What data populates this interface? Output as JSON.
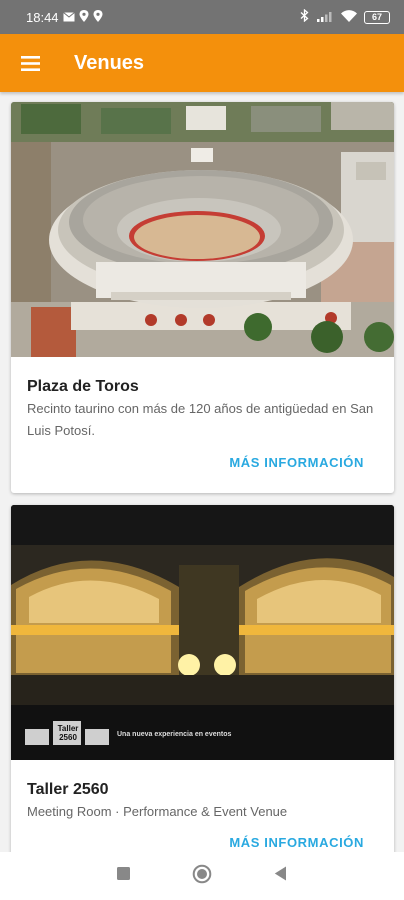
{
  "status_bar": {
    "time": "18:44",
    "battery_level": "67"
  },
  "app_bar": {
    "title": "Venues",
    "color": "#f4900c"
  },
  "venues": [
    {
      "name": "Plaza de Toros",
      "description": "Recinto taurino con más de 120 años de antigüedad en San Luis Potosí.",
      "action_label": "MÁS INFORMACIÓN"
    },
    {
      "name": "Taller 2560",
      "description": "Meeting Room · Performance & Event Venue",
      "action_label": "MÁS INFORMACIÓN",
      "image_caption": "Una nueva experiencia en eventos",
      "image_logo": "Taller 2560"
    }
  ],
  "colors": {
    "status_bar": "#737373",
    "accent": "#29a9e0"
  }
}
